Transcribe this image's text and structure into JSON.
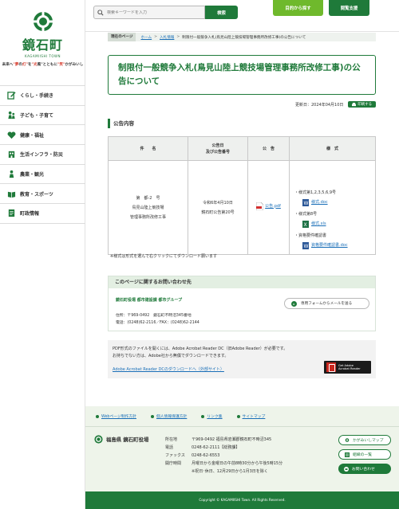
{
  "sidebar": {
    "logo_title": "鏡石町",
    "logo_sub": "KAGAMIISHI TOWN",
    "tagline_pre": "未来へ",
    "tagline_q1": "\"夢",
    "tagline_mid1": "の",
    "tagline_q2": "灯\"",
    "tagline_mid2": "を",
    "tagline_q3": "\"光",
    "tagline_mid3": "風\"とともに",
    "tagline_q4": "\"笑\"",
    "tagline_post": "かがみいし",
    "items": [
      {
        "label": "くらし・手続き",
        "icon": "pencil-icon"
      },
      {
        "label": "子ども・子育て",
        "icon": "child-icon"
      },
      {
        "label": "健康・福祉",
        "icon": "heart-icon"
      },
      {
        "label": "生活インフラ・防災",
        "icon": "building-icon"
      },
      {
        "label": "農業・観光",
        "icon": "farm-icon"
      },
      {
        "label": "教育・スポーツ",
        "icon": "book-icon"
      },
      {
        "label": "町政情報",
        "icon": "document-icon"
      }
    ]
  },
  "header": {
    "search_placeholder": "検索キーワードを入力",
    "search_button": "検索",
    "purpose_button": "目的から探す",
    "access_button": "閲覧支援"
  },
  "breadcrumb": {
    "label": "現在のページ",
    "items": [
      "ホーム",
      "入札情報",
      "制限付一般競争入札(鳥見山陸上競技場管理事務所改修工事)の公告について"
    ]
  },
  "page": {
    "title": "制限付一般競争入札(鳥見山陸上競技場管理事務所改修工事)の公告について",
    "updated": "更新日：2024年04月10日",
    "print_label": "印刷する",
    "section_title": "公告内容"
  },
  "table": {
    "headers": [
      "件　　名",
      "公告日\n及び公告番号",
      "公　告",
      "様　式"
    ],
    "row": {
      "name_lines": [
        "第　都-2　号",
        "鳥見山陸上競技場",
        "管理事務所改修工事"
      ],
      "date_lines": [
        "令和6年4月10日",
        "鏡石町公告第20号"
      ],
      "notice_link": "公告.pdf",
      "formats": [
        {
          "label": "・様式第1,2,3,5,6,9号",
          "file": "様式.doc"
        },
        {
          "label": "・様式第8号",
          "file": "様式.xls"
        },
        {
          "label": "・資格要件確認書",
          "file": "資格要件確認書.doc"
        }
      ]
    },
    "note": "※様式は形式を選んで右クリックにてダウンロード願います"
  },
  "contact": {
    "heading": "このページに関するお問い合わせ先",
    "dept": "鏡石町役場 都市建設課 都市グループ",
    "address": "住所：〒969-0492　鏡石町不時沼345番地",
    "phone": "電話：(0248)62-2116／FAX：(0248)62-2144",
    "mail_button": "専用フォームからメールを送る"
  },
  "adobe": {
    "text1": "PDF形式のファイルを開くには、Adobe Acrobat Reader DC（旧Adobe Reader）が必要です。",
    "text2": "お持ちでない方は、Adobe社から無償でダウンロードできます。",
    "link": "Adobe Acrobat Reader DCのダウンロードへ（外部サイト）",
    "badge1": "Get Adobe",
    "badge2": "Acrobat Reader"
  },
  "footer": {
    "links": [
      "Webページ制作方針",
      "個人情報保護方針",
      "リンク集",
      "サイトマップ"
    ],
    "org": "福島県 鏡石町役場",
    "info": [
      {
        "k": "所在地",
        "v": "〒969-0492 福島県岩瀬郡鏡石町不時沼345"
      },
      {
        "k": "電話",
        "v": "0248-62-2111【総務課】"
      },
      {
        "k": "ファックス",
        "v": "0248-62-6553"
      },
      {
        "k": "開庁時間",
        "v": "月曜日から金曜日の午前8時30分から午後5時15分"
      },
      {
        "k": "",
        "v": "※祝日･休日、12月29日から1月3日を除く"
      }
    ],
    "buttons": [
      "かがみいしマップ",
      "組織の一覧",
      "お問い合わせ"
    ],
    "copyright": "Copyright © KAGAMIISHI Town. All Rights Reserved."
  },
  "colors": {
    "brand": "#1f7a3a",
    "accent": "#6fb92c"
  }
}
